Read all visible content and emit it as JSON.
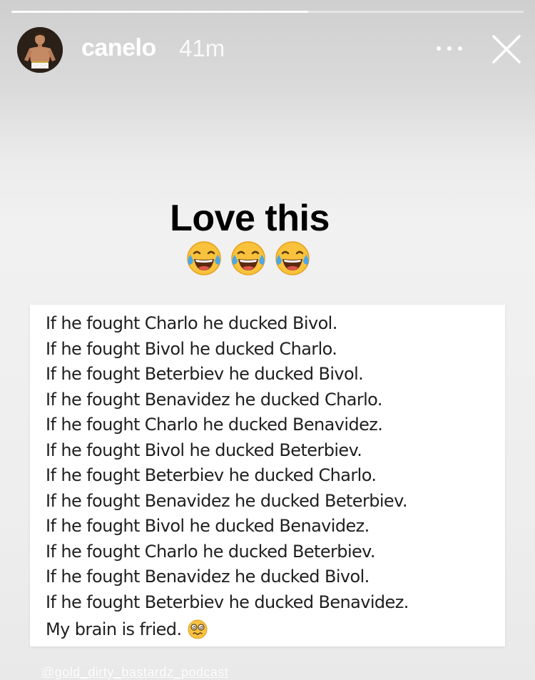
{
  "story": {
    "progress": 0.58,
    "username": "canelo",
    "timestamp": "41m",
    "caption": "Love this"
  },
  "post": {
    "lines": [
      "If he fought Charlo he ducked Bivol.",
      "If he fought Bivol he ducked Charlo.",
      "If he fought Beterbiev he ducked Bivol.",
      "If he fought Benavidez he ducked Charlo.",
      "If he fought Charlo he ducked Benavidez.",
      "If he fought Bivol he ducked Beterbiev.",
      "If he fought Beterbiev he ducked Charlo.",
      "If he fought Benavidez he ducked Beterbiev.",
      "If he fought Bivol he ducked Benavidez.",
      "If he fought Charlo he ducked Beterbiev.",
      "If he fought Benavidez he ducked Bivol.",
      "If he fought Beterbiev he ducked Benavidez."
    ],
    "final_line": "My brain is fried."
  },
  "watermark": "@gold_dirty_bastardz_podcast",
  "icons": {
    "more": "more-horizontal-icon",
    "close": "close-icon",
    "laughing": "face-with-tears-of-joy-icon",
    "dizzy": "dizzy-face-icon"
  }
}
